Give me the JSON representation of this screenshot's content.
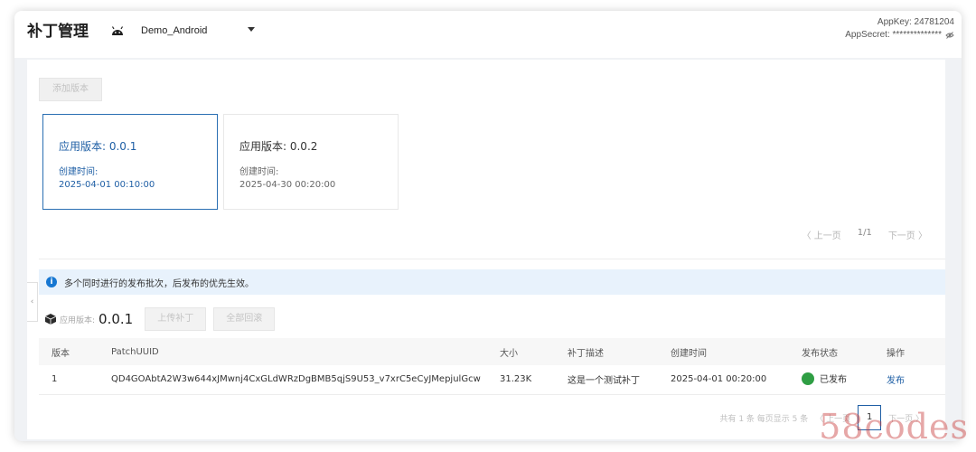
{
  "header": {
    "title": "补丁管理",
    "app_name": "Demo_Android",
    "app_icon": "android-icon",
    "app_key": "AppKey: 24781204",
    "app_secret": "AppSecret: **************"
  },
  "toolbar": {
    "add_version_label": "添加版本"
  },
  "versions": [
    {
      "title": "应用版本: 0.0.1",
      "created_label": "创建时间:",
      "created_time": "2025-04-01 00:10:00",
      "active": true
    },
    {
      "title": "应用版本: 0.0.2",
      "created_label": "创建时间:",
      "created_time": "2025-04-30 00:20:00",
      "active": false
    }
  ],
  "card_pager": {
    "prev": "〈 上一页",
    "page": "1/1",
    "next": "下一页 〉"
  },
  "notice": {
    "text": "多个同时进行的发布批次，后发布的优先生效。"
  },
  "patch_bar": {
    "label": "应用版本:",
    "version": "0.0.1",
    "upload_label": "上传补丁",
    "rollback_label": "全部回滚"
  },
  "table": {
    "headers": [
      "版本",
      "PatchUUID",
      "大小",
      "补丁描述",
      "创建时间",
      "发布状态",
      "操作"
    ],
    "rows": [
      {
        "version": "1",
        "uuid": "QD4GOAbtA2W3w644xJMwnj4CxGLdWRzDgBMB5qjS9U53_v7xrC5eCyJMepjulGcw",
        "size": "31.23K",
        "desc": "这是一个测试补丁",
        "created": "2025-04-01 00:20:00",
        "status": "已发布",
        "action": "发布"
      }
    ]
  },
  "table_pager": {
    "summary": "共有 1 条  每页显示 5 条",
    "prev": "〈 上一页",
    "page": "1",
    "next": "下一页 〉"
  },
  "colors": {
    "accent": "#1f5fa5",
    "published": "#2f9e44",
    "notice_bg": "#e8f2fc"
  },
  "watermark": "58codes"
}
